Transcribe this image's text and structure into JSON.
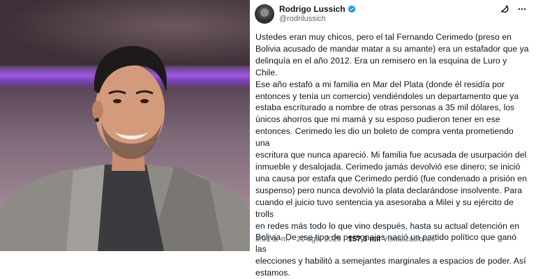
{
  "tweet": {
    "author_name": "Rodrigo Lussich",
    "author_handle": "@rodrilussich",
    "body_lines": [
      "Ustedes eran muy chicos, pero el tal Fernando Cerimedo (preso en",
      "Bolivia acusado de mandar matar a su amante) era un estafador que ya",
      "delinquía en el año 2012. Era un remisero en la esquina de Luro y Chile.",
      "Ese año estafó a mi familia en Mar del Plata (donde él residía por",
      "entonces y tenía un comercio) vendiéndoles un departamento que ya",
      "estaba escriturado a nombre de otras personas a 35 mil dólares, los",
      "únicos ahorros que mi mamá y su esposo pudieron tener en ese",
      "entonces. Cerimedo les dio un boleto de compra venta prometiendo una",
      "escritura que nunca apareció. Mi familia fue acusada de usurpación del",
      "inmueble y desalojada. Cerimedo jamás devolvió ese dinero; se inició",
      "una causa por estafa que Cerimedo perdió (fue condenado a prisión en",
      "suspenso) pero nunca devolvió la plata declarándose insolvente. Para",
      "cuando el juicio tuvo sentencia ya asesoraba a Milei y su ejército de trolls",
      "en redes más todo lo que vino después, hasta su actual detención en",
      "Bolivia. De ese tipo de personajes nació un partido político que ganó las",
      "elecciones y habilitó a semejantes marginales a espacios de poder. Así",
      "estamos."
    ],
    "time": "8:01 a. m.",
    "separator": "·",
    "date": "20 ago. 2026",
    "views_count": "157,3 mil",
    "views_label": "Visualizaciones"
  },
  "icons": {
    "verified": "verified-badge-icon",
    "grok": "grok-icon",
    "more": "more-options-icon"
  },
  "colors": {
    "verified": "#1d9bf0",
    "text": "#0f1419",
    "muted": "#536471"
  }
}
